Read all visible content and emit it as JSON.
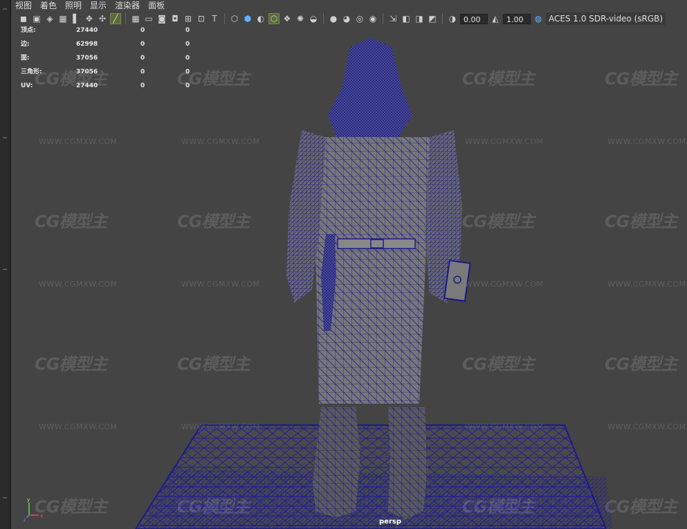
{
  "menu": [
    "视图",
    "着色",
    "照明",
    "显示",
    "渲染器",
    "面板"
  ],
  "toolbar": {
    "exposure_value": "0.00",
    "gamma_value": "1.00",
    "color_space": "ACES 1.0 SDR-video (sRGB)",
    "icons_group1": [
      "camera-icon",
      "camera-attributes-icon",
      "bookmarks-icon",
      "image-plane-icon",
      "grease-pencil-icon",
      "move-tool-icon",
      "snap-icon"
    ],
    "icons_group2": [
      "grid-icon",
      "film-gate-icon",
      "resolution-gate-icon",
      "gate-mask-icon",
      "field-chart-icon",
      "safe-action-icon",
      "safe-title-icon"
    ],
    "icons_group3": [
      "wireframe-icon",
      "smooth-shade-icon",
      "use-default-material-icon",
      "wireframe-on-shaded-icon",
      "xray-icon",
      "use-all-lights-icon",
      "shadows-icon"
    ],
    "icons_group4": [
      "ambient-occlusion-icon",
      "motion-blur-icon",
      "antialiasing-icon",
      "depth-of-field-icon"
    ],
    "icons_group5": [
      "isolate-select-icon",
      "xray-joints-icon",
      "xray-active-icon",
      "textured-icon"
    ]
  },
  "hud": {
    "rows": [
      {
        "label": "顶点:",
        "c1": "27440",
        "c2": "0",
        "c3": "0"
      },
      {
        "label": "边:",
        "c1": "62998",
        "c2": "0",
        "c3": "0"
      },
      {
        "label": "面:",
        "c1": "37056",
        "c2": "0",
        "c3": "0"
      },
      {
        "label": "三角形:",
        "c1": "37056",
        "c2": "0",
        "c3": "0"
      },
      {
        "label": "UV:",
        "c1": "27440",
        "c2": "0",
        "c3": "0"
      }
    ]
  },
  "viewport": {
    "camera_name": "persp",
    "wireframe_color": "#1a1a8c",
    "background_color": "#444444"
  },
  "watermark": {
    "logo": "CG模型主",
    "url": "WWW.CGMXW.COM"
  },
  "axis": {
    "x": "x",
    "y": "y",
    "z": "z"
  }
}
